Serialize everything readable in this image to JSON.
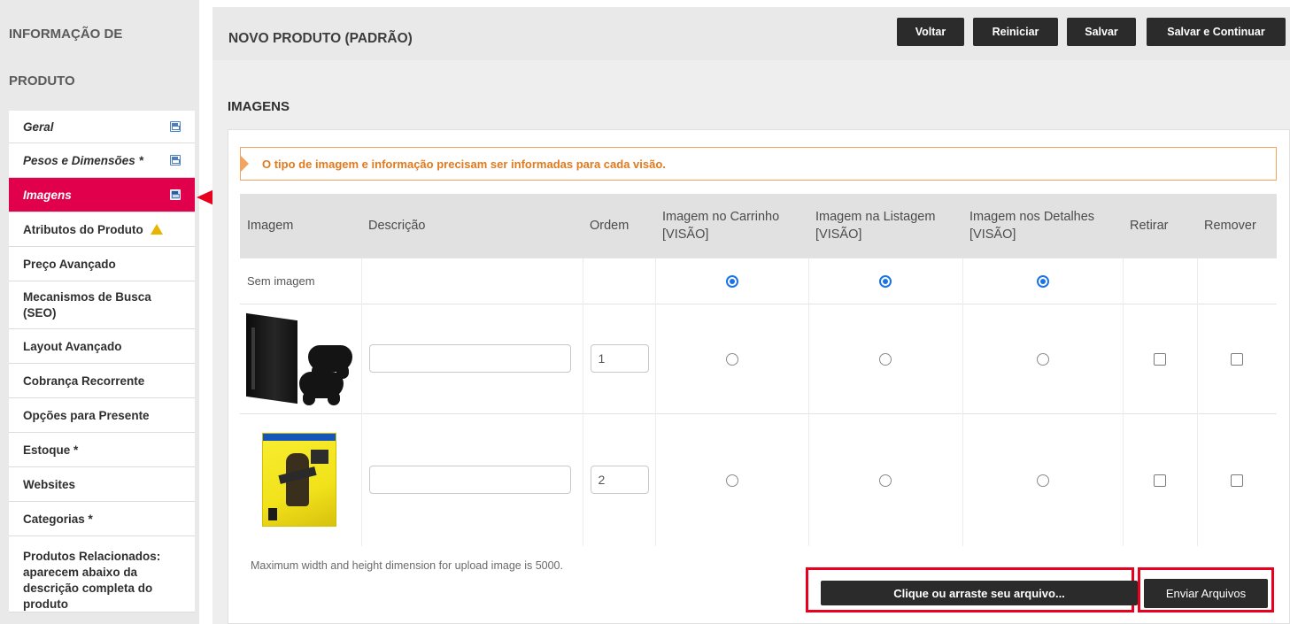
{
  "sidebar": {
    "title_line1": "INFORMAÇÃO DE",
    "title_line2": "PRODUTO",
    "items": [
      {
        "label": "Geral"
      },
      {
        "label": "Pesos e Dimensões *"
      },
      {
        "label": "Imagens"
      },
      {
        "label": "Atributos do Produto"
      },
      {
        "label": "Preço Avançado"
      },
      {
        "label": "Mecanismos de Busca (SEO)"
      },
      {
        "label": "Layout Avançado"
      },
      {
        "label": "Cobrança Recorrente"
      },
      {
        "label": "Opções para Presente"
      },
      {
        "label": "Estoque *"
      },
      {
        "label": "Websites"
      },
      {
        "label": "Categorias *"
      },
      {
        "label": "Produtos Relacionados: aparecem abaixo da descrição completa do produto"
      }
    ],
    "active_color": "#e1004c"
  },
  "header": {
    "title": "NOVO PRODUTO (PADRÃO)",
    "buttons": {
      "voltar": "Voltar",
      "reiniciar": "Reiniciar",
      "salvar": "Salvar",
      "salvar_continuar": "Salvar e Continuar"
    }
  },
  "section": {
    "title": "IMAGENS",
    "notice": "O tipo de imagem e informação precisam ser informadas para cada visão.",
    "notice_color": "#e07a1d"
  },
  "table": {
    "headers": {
      "imagem": "Imagem",
      "descricao": "Descrição",
      "ordem": "Ordem",
      "carrinho": "Imagem no Carrinho [VISÃO]",
      "listagem": "Imagem na Listagem [VISÃO]",
      "detalhes": "Imagem nos Detalhes [VISÃO]",
      "retirar": "Retirar",
      "remover": "Remover"
    },
    "no_image_label": "Sem imagem",
    "rows": [
      {
        "description": "",
        "order": "1",
        "image": "ps4-console-with-controllers"
      },
      {
        "description": "",
        "order": "2",
        "image": "cyberpunk-2077-ps4-game-cover"
      }
    ]
  },
  "upload": {
    "note": "Maximum width and height dimension for upload image is 5000.",
    "choose_label": "Clique ou arraste seu arquivo...",
    "send_label": "Enviar Arquivos",
    "highlight_color": "#e8001e"
  }
}
